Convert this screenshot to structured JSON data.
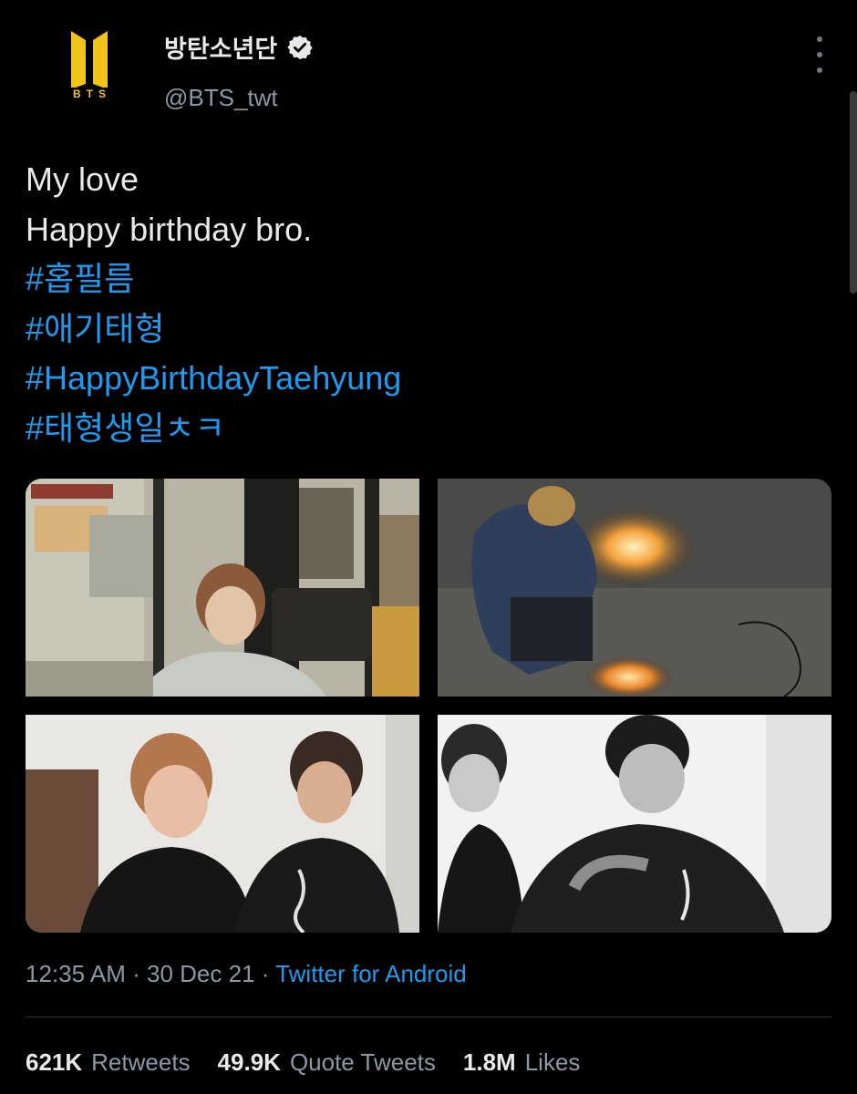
{
  "account": {
    "display_name": "방탄소년단",
    "handle": "@BTS_twt",
    "verified": true,
    "avatar_logo_text": "BTS",
    "avatar_color": "#f0c419"
  },
  "tweet": {
    "lines": [
      {
        "type": "text",
        "value": "My love"
      },
      {
        "type": "text",
        "value": "Happy birthday bro."
      },
      {
        "type": "hashtag",
        "value": "#홉필름"
      },
      {
        "type": "hashtag",
        "value": "#애기태형"
      },
      {
        "type": "hashtag",
        "value": "#HappyBirthdayTaehyung"
      },
      {
        "type": "hashtag",
        "value": "#태형생일ㅊㅋ"
      }
    ],
    "media_count": 4,
    "time": "12:35 AM",
    "separator": "·",
    "date": "30 Dec 21",
    "source": "Twitter for Android"
  },
  "stats": {
    "retweets_count": "621K",
    "retweets_label": "Retweets",
    "quote_count": "49.9K",
    "quote_label": "Quote Tweets",
    "likes_count": "1.8M",
    "likes_label": "Likes"
  },
  "colors": {
    "background": "#000000",
    "text_primary": "#e7e9ea",
    "text_secondary": "#8b98a5",
    "link": "#1d9bf0",
    "divider": "#2f3336"
  },
  "icons": {
    "verified": "verified-badge-icon",
    "more": "more-vertical-icon"
  }
}
